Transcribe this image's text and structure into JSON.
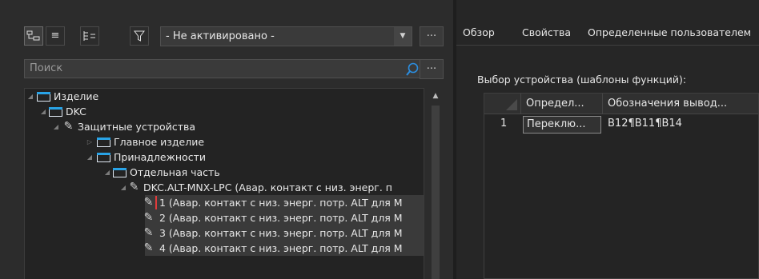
{
  "toolbar": {
    "filter_combo_value": "- Не активировано -",
    "more_label": "...",
    "search_placeholder": "Поиск",
    "search_more_label": "..."
  },
  "tree": {
    "rows": [
      {
        "label": "Изделие"
      },
      {
        "label": "DKC"
      },
      {
        "label": "Защитные устройства"
      },
      {
        "label": "Главное изделие"
      },
      {
        "label": "Принадлежности"
      },
      {
        "label": "Отдельная часть"
      },
      {
        "label": "DKC.ALT-MNX-LPC (Авар. контакт с низ. энерг. п"
      },
      {
        "label": "1 (Авар. контакт с низ. энерг. потр. ALT для M"
      },
      {
        "label": "2 (Авар. контакт с низ. энерг. потр. ALT для M"
      },
      {
        "label": "3 (Авар. контакт с низ. энерг. потр. ALT для M"
      },
      {
        "label": "4 (Авар. контакт с низ. энерг. потр. ALT для M"
      }
    ]
  },
  "right": {
    "tabs": [
      "Обзор",
      "Свойства",
      "Определенные пользователем"
    ],
    "device_selection_label": "Выбор устройства (шаблоны функций):",
    "grid": {
      "headers": [
        "Определ...",
        "Обозначения вывод..."
      ],
      "rows": [
        {
          "num": "1",
          "def": "Переклю...",
          "pins": "B12¶B11¶B14"
        }
      ]
    }
  },
  "colors": {
    "accent_folder": "#29a3e6",
    "selection_marker": "#e23b3b",
    "background": "#2b2b2b"
  }
}
